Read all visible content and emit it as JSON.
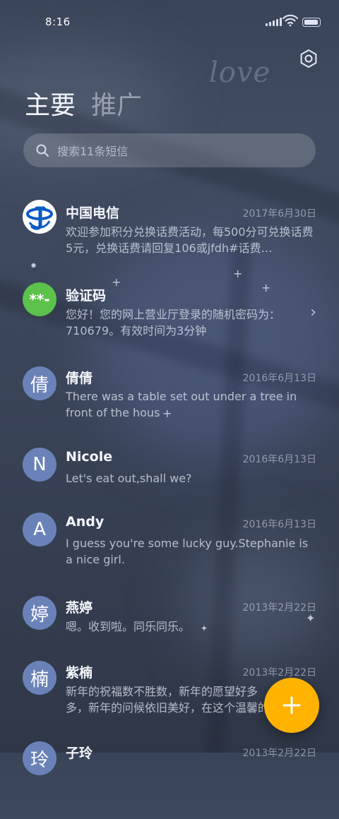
{
  "status_bar": {
    "time": "8:16"
  },
  "tabs": [
    {
      "label": "主要"
    },
    {
      "label": "推广"
    }
  ],
  "background": {
    "overlay_text": "love"
  },
  "search": {
    "placeholder": "搜索11条短信"
  },
  "conversations": [
    {
      "name": "中国电信",
      "date": "2017年6月30日",
      "preview": "欢迎参加积分兑换话费活动，每500分可兑换话费5元，兑换话费请回复106或jfdh#话费…",
      "avatar": {
        "type": "logo",
        "icon": "china-telecom-logo"
      }
    },
    {
      "name": "验证码",
      "date": "",
      "preview": "您好！您的网上营业厅登录的随机密码为：710679。有效时间为3分钟",
      "avatar": {
        "type": "text",
        "text": "**-",
        "color": "#5cc24b"
      },
      "chevron": "›"
    },
    {
      "name": "倩倩",
      "date": "2016年6月13日",
      "preview": "There was a table set out under a tree in front of the hous",
      "avatar": {
        "type": "text",
        "text": "倩",
        "color": "#6b82b9"
      }
    },
    {
      "name": "Nicole",
      "date": "2016年6月13日",
      "preview": "Let's eat out,shall we?",
      "avatar": {
        "type": "text",
        "text": "N",
        "color": "#6b82b9"
      }
    },
    {
      "name": "Andy",
      "date": "2016年6月13日",
      "preview": "I guess you're some lucky guy.Stephanie is a nice girl.",
      "avatar": {
        "type": "text",
        "text": "A",
        "color": "#6b82b9"
      }
    },
    {
      "name": "燕婷",
      "date": "2013年2月22日",
      "preview": "嗯。收到啦。同乐同乐。",
      "avatar": {
        "type": "text",
        "text": "婷",
        "color": "#6b82b9"
      }
    },
    {
      "name": "紫楠",
      "date": "2013年2月22日",
      "preview": "新年的祝福数不胜数，新年的愿望好多多，新年的问候依旧美好，在这个温馨的",
      "avatar": {
        "type": "text",
        "text": "楠",
        "color": "#6b82b9"
      }
    },
    {
      "name": "子玲",
      "date": "2013年2月22日",
      "preview": "",
      "avatar": {
        "type": "text",
        "text": "玲",
        "color": "#6b82b9"
      }
    }
  ],
  "fab": {
    "icon": "plus-icon",
    "color": "#ffb300"
  },
  "colors": {
    "accent": "#ffb300",
    "avatar_default": "#6b82b9",
    "verify_avatar": "#5cc24b"
  }
}
